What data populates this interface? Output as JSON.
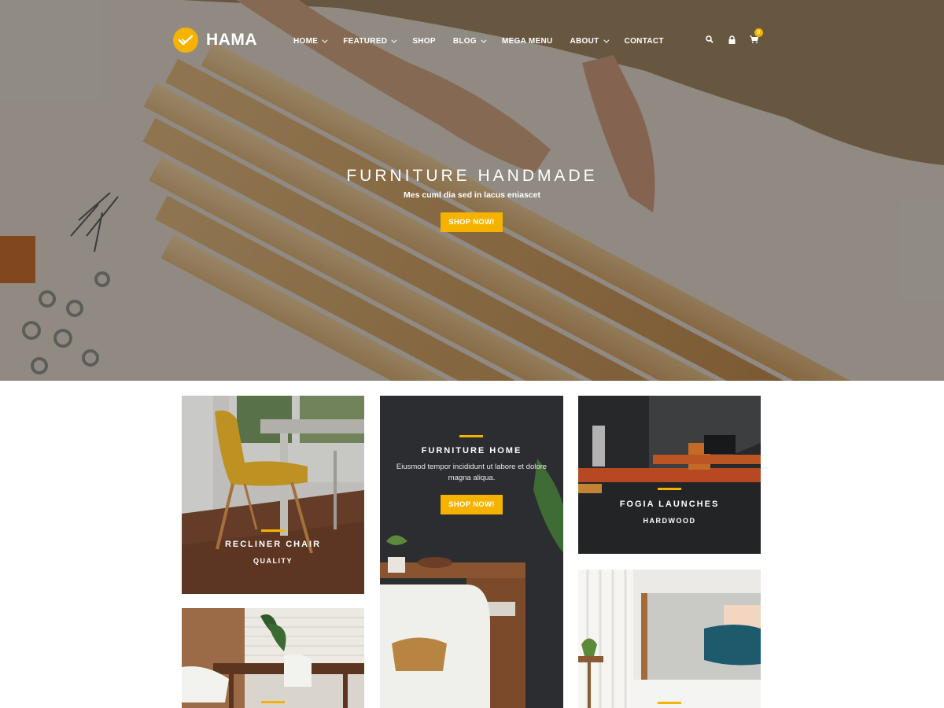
{
  "brand": {
    "name": "HAMA",
    "accent": "#f5b300"
  },
  "nav": {
    "items": [
      {
        "label": "HOME",
        "has_dropdown": true
      },
      {
        "label": "FEATURED",
        "has_dropdown": true
      },
      {
        "label": "SHOP",
        "has_dropdown": false
      },
      {
        "label": "BLOG",
        "has_dropdown": true
      },
      {
        "label": "MEGA MENU",
        "has_dropdown": false
      },
      {
        "label": "ABOUT",
        "has_dropdown": true
      },
      {
        "label": "CONTACT",
        "has_dropdown": false
      }
    ],
    "tools": {
      "search_icon": "search-icon",
      "account_icon": "lock-icon",
      "cart_icon": "cart-icon",
      "cart_count": "0"
    }
  },
  "hero": {
    "title": "FURNITURE HANDMADE",
    "subtitle": "Mes cuml dia sed in lacus eniascet",
    "button": "SHOP NOW!"
  },
  "cards": {
    "recliner": {
      "title": "RECLINER CHAIR",
      "sub": "QUALITY"
    },
    "home": {
      "title": "FURNITURE HOME",
      "text": "Eiusmod tempor incididunt ut labore et dolore magna aliqua.",
      "button": "SHOP NOW!"
    },
    "fogia": {
      "title": "FOGIA LAUNCHES",
      "sub": "HARDWOOD"
    }
  }
}
